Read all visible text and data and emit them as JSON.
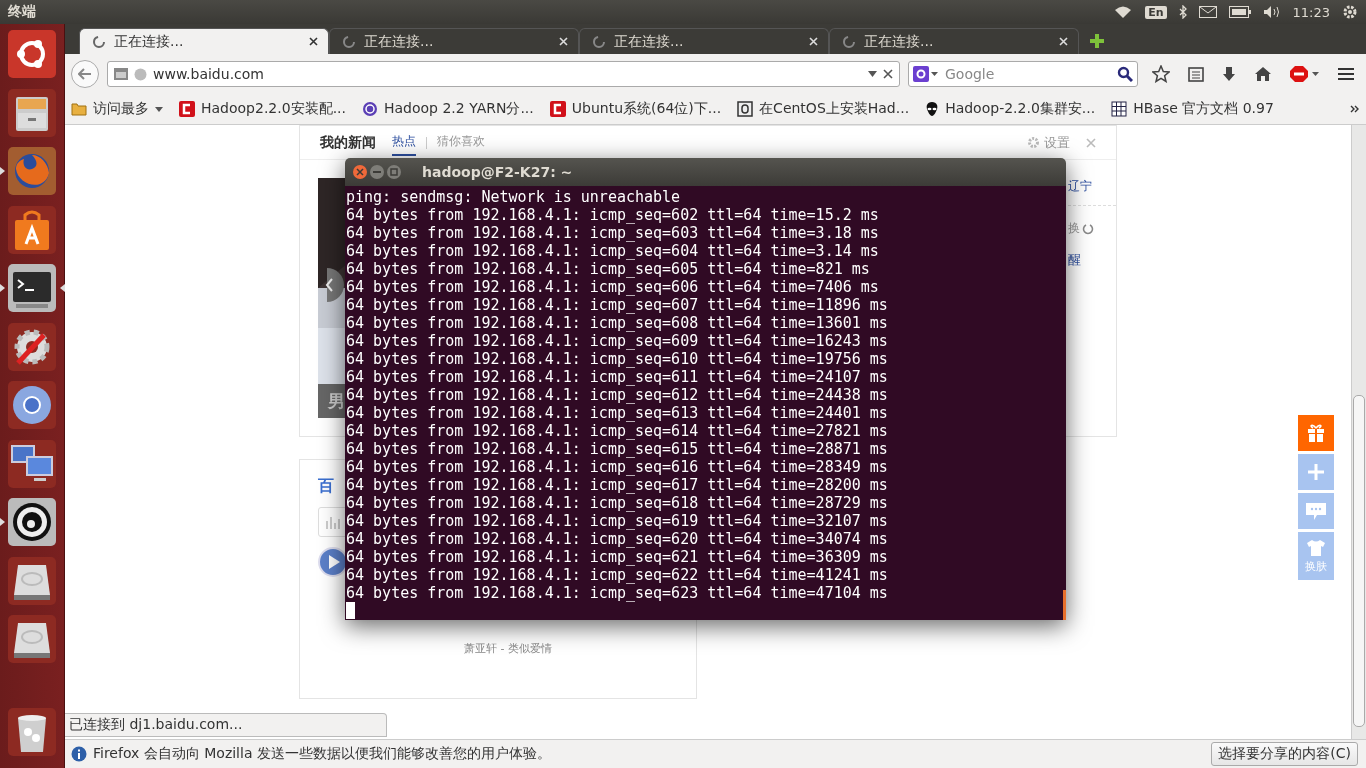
{
  "top_panel": {
    "title": "终端",
    "keyboard": "En",
    "clock": "11:23"
  },
  "launcher": [
    {
      "kind": "ubuntu",
      "running": false,
      "focused": false
    },
    {
      "kind": "files",
      "running": false,
      "focused": false
    },
    {
      "kind": "firefox",
      "running": true,
      "focused": false
    },
    {
      "kind": "store",
      "running": false,
      "focused": false
    },
    {
      "kind": "terminal",
      "running": true,
      "focused": true
    },
    {
      "kind": "settings",
      "running": false,
      "focused": false
    },
    {
      "kind": "chromium",
      "running": false,
      "focused": false
    },
    {
      "kind": "remote",
      "running": false,
      "focused": false
    },
    {
      "kind": "ring",
      "running": true,
      "focused": false
    },
    {
      "kind": "drive",
      "running": false,
      "focused": false
    },
    {
      "kind": "drive",
      "running": false,
      "focused": false
    },
    {
      "kind": "trash",
      "running": false,
      "focused": false
    }
  ],
  "browser": {
    "tabs": [
      {
        "label": "正在连接...",
        "selected": true
      },
      {
        "label": "正在连接...",
        "selected": false
      },
      {
        "label": "正在连接...",
        "selected": false
      },
      {
        "label": "正在连接...",
        "selected": false
      }
    ],
    "address": "www.baidu.com",
    "search_placeholder": "Google",
    "bookmarks": [
      {
        "kind": "folder",
        "label": "访问最多"
      },
      {
        "kind": "red",
        "label": "Hadoop2.2.0安装配..."
      },
      {
        "kind": "swirl",
        "label": "Hadoop 2.2 YARN分..."
      },
      {
        "kind": "red",
        "label": "Ubuntu系统(64位)下..."
      },
      {
        "kind": "square",
        "label": "在CentOS上安装Had..."
      },
      {
        "kind": "alien",
        "label": "Hadoop-2.2.0集群安..."
      },
      {
        "kind": "grid",
        "label": "HBase 官方文档 0.97"
      }
    ],
    "page": {
      "news": {
        "title": "我的新闻",
        "tabs": [
          {
            "label": "热点",
            "selected": true
          },
          {
            "label": "猜你喜欢",
            "selected": false
          }
        ],
        "settings": "设置",
        "region": "辽宁",
        "refresh": "换",
        "headline_fragment": "醒",
        "photo_caption": "男"
      },
      "music": {
        "logo_fragment": "百",
        "song": "萧亚轩 - 类似爱情"
      },
      "side_buttons": [
        {
          "kind": "gift"
        },
        {
          "kind": "plus"
        },
        {
          "kind": "chat"
        },
        {
          "kind": "shirt",
          "label": "换肤"
        }
      ]
    },
    "status_tooltip": "已连接到 dj1.baidu.com...",
    "notification": {
      "message": "Firefox 会自动向 Mozilla 发送一些数据以便我们能够改善您的用户体验。",
      "button": "选择要分享的内容(C)"
    }
  },
  "terminal": {
    "title": "hadoop@F2-K27: ~",
    "lines": [
      "ping: sendmsg: Network is unreachable",
      "64 bytes from 192.168.4.1: icmp_seq=602 ttl=64 time=15.2 ms",
      "64 bytes from 192.168.4.1: icmp_seq=603 ttl=64 time=3.18 ms",
      "64 bytes from 192.168.4.1: icmp_seq=604 ttl=64 time=3.14 ms",
      "64 bytes from 192.168.4.1: icmp_seq=605 ttl=64 time=821 ms",
      "64 bytes from 192.168.4.1: icmp_seq=606 ttl=64 time=7406 ms",
      "64 bytes from 192.168.4.1: icmp_seq=607 ttl=64 time=11896 ms",
      "64 bytes from 192.168.4.1: icmp_seq=608 ttl=64 time=13601 ms",
      "64 bytes from 192.168.4.1: icmp_seq=609 ttl=64 time=16243 ms",
      "64 bytes from 192.168.4.1: icmp_seq=610 ttl=64 time=19756 ms",
      "64 bytes from 192.168.4.1: icmp_seq=611 ttl=64 time=24107 ms",
      "64 bytes from 192.168.4.1: icmp_seq=612 ttl=64 time=24438 ms",
      "64 bytes from 192.168.4.1: icmp_seq=613 ttl=64 time=24401 ms",
      "64 bytes from 192.168.4.1: icmp_seq=614 ttl=64 time=27821 ms",
      "64 bytes from 192.168.4.1: icmp_seq=615 ttl=64 time=28871 ms",
      "64 bytes from 192.168.4.1: icmp_seq=616 ttl=64 time=28349 ms",
      "64 bytes from 192.168.4.1: icmp_seq=617 ttl=64 time=28200 ms",
      "64 bytes from 192.168.4.1: icmp_seq=618 ttl=64 time=28729 ms",
      "64 bytes from 192.168.4.1: icmp_seq=619 ttl=64 time=32107 ms",
      "64 bytes from 192.168.4.1: icmp_seq=620 ttl=64 time=34074 ms",
      "64 bytes from 192.168.4.1: icmp_seq=621 ttl=64 time=36309 ms",
      "64 bytes from 192.168.4.1: icmp_seq=622 ttl=64 time=41241 ms",
      "64 bytes from 192.168.4.1: icmp_seq=623 ttl=64 time=47104 ms"
    ]
  }
}
